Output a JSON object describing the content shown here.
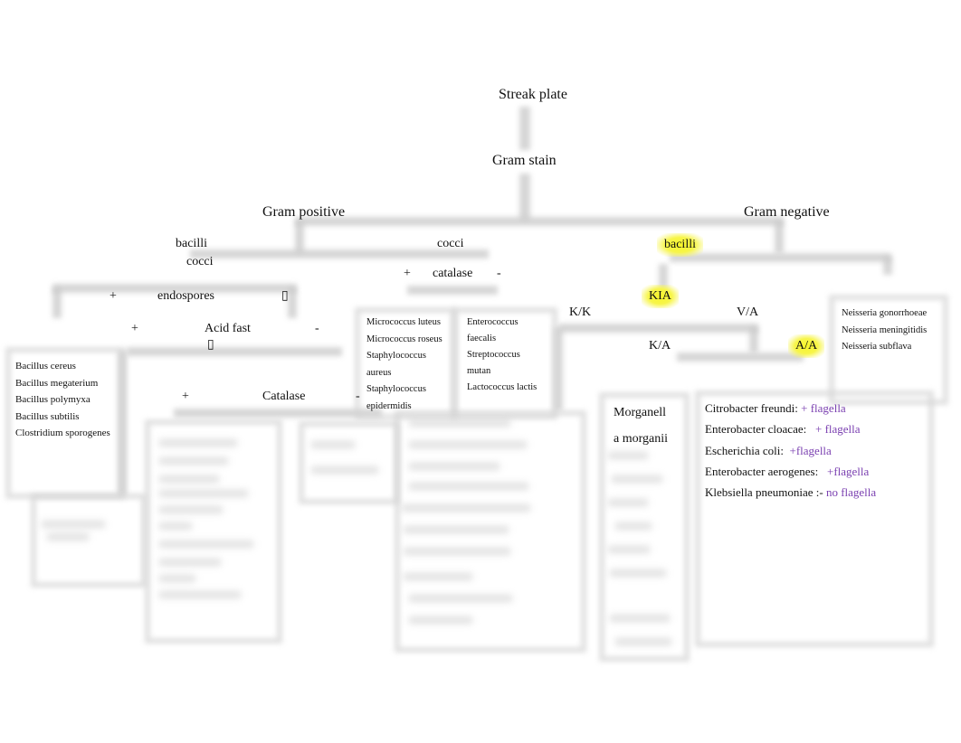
{
  "diagram": {
    "root": "Streak plate",
    "gram_stain": "Gram stain",
    "gram_positive": {
      "label": "Gram positive",
      "bacilli": "bacilli",
      "cocci_sub": "cocci",
      "endospores": {
        "plus": "+",
        "label": "endospores",
        "minus": ""
      },
      "acid_fast": {
        "plus": "+",
        "label": "Acid fast",
        "minus": "-",
        "glyph": ""
      },
      "bacillus_list": [
        "Bacillus cereus",
        "Bacillus megaterium",
        "Bacillus polymyxa",
        "Bacillus subtilis",
        "Clostridium sporogenes"
      ],
      "catalase2": {
        "plus": "+",
        "label": "Catalase",
        "minus": "-"
      },
      "cocci": "cocci",
      "catalase": {
        "plus": "+",
        "label": "catalase",
        "minus": "-"
      },
      "catalase_pos_list": [
        "Micrococcus luteus",
        "Micrococcus roseus",
        "Staphylococcus",
        "aureus",
        "Staphylococcus",
        "epidermidis"
      ],
      "catalase_neg_list": [
        "Enterococcus",
        "faecalis",
        "Streptococcus",
        "mutan",
        "Lactococcus lactis"
      ]
    },
    "gram_negative": {
      "label": "Gram negative",
      "bacilli": "bacilli",
      "kia": "KIA",
      "kk": "K/K",
      "va": "V/A",
      "ka": "K/A",
      "aa": "A/A",
      "neisseria_list": [
        "Neisseria gonorrhoeae",
        "Neisseria meningitidis",
        "Neisseria subflava"
      ],
      "morganella": [
        "Morganell",
        "a morganii"
      ],
      "aa_list": [
        {
          "name": "Citrobacter freundi:",
          "note": "+ flagella"
        },
        {
          "name": "Enterobacter cloacae:",
          "note": "+ flagella"
        },
        {
          "name": "Escherichia coli:",
          "note": "+flagella"
        },
        {
          "name": "Enterobacter aerogenes:",
          "note": "+flagella"
        },
        {
          "name": "Klebsiella pneumoniae :-",
          "note": "no flagella"
        }
      ]
    }
  },
  "colors": {
    "highlight": "#f7f52a",
    "note": "#7a3fb0"
  }
}
